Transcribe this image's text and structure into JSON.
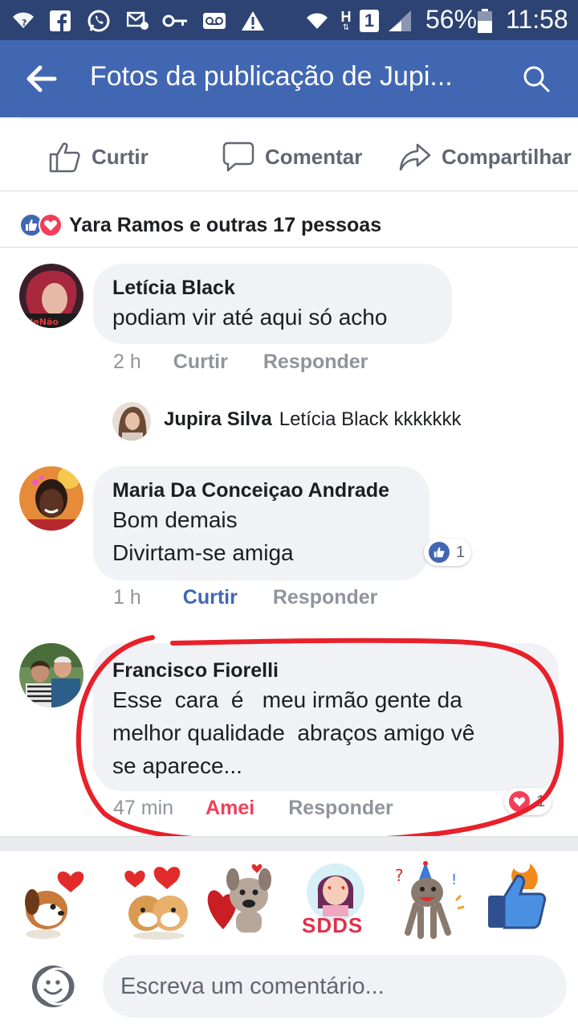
{
  "status_bar": {
    "battery": "56%",
    "time": "11:58",
    "network_h": "H",
    "sim": "1",
    "icons": [
      "wifi-question-icon",
      "facebook-icon",
      "whatsapp-icon",
      "mail-icon",
      "key-icon",
      "voicemail-icon",
      "warning-icon",
      "wifi-icon",
      "signal-icon",
      "battery-icon"
    ]
  },
  "app_bar": {
    "title": "Fotos da publicação de Jupi...",
    "back_icon": "arrow-left-icon",
    "search_icon": "search-icon"
  },
  "actions": {
    "like": "Curtir",
    "comment": "Comentar",
    "share": "Compartilhar"
  },
  "reactions_summary": {
    "label": "Yara Ramos e outras 17 pessoas"
  },
  "comments": [
    {
      "name": "Letícia Black",
      "text": "podiam vir até aqui só acho",
      "time": "2 h",
      "like": "Curtir",
      "reply": "Responder"
    },
    {
      "name": "Maria Da Conceiçao Andrade",
      "line1": "Bom demais",
      "line2": "Divirtam-se amiga",
      "time": "1 h",
      "like": "Curtir",
      "reply": "Responder",
      "reaction_count": "1"
    },
    {
      "name": "Francisco Fiorelli",
      "line1": "Esse  cara  é   meu irmão gente da",
      "line2": "melhor qualidade  abraços amigo vê",
      "line3": "se aparece...",
      "time": "47 min",
      "like": "Amei",
      "reply": "Responder",
      "reaction_count": "1"
    }
  ],
  "reply": {
    "name": "Jupira Silva",
    "text": "Letícia Black kkkkkkk"
  },
  "sticker_text": "SDDS",
  "composer": {
    "placeholder": "Escreva um comentário..."
  },
  "colors": {
    "status_bar": "#2d4373",
    "app_bar": "#4267b2",
    "like_blue": "#4267b2",
    "love_red": "#f33e58",
    "annotation_red": "#e8202a"
  }
}
